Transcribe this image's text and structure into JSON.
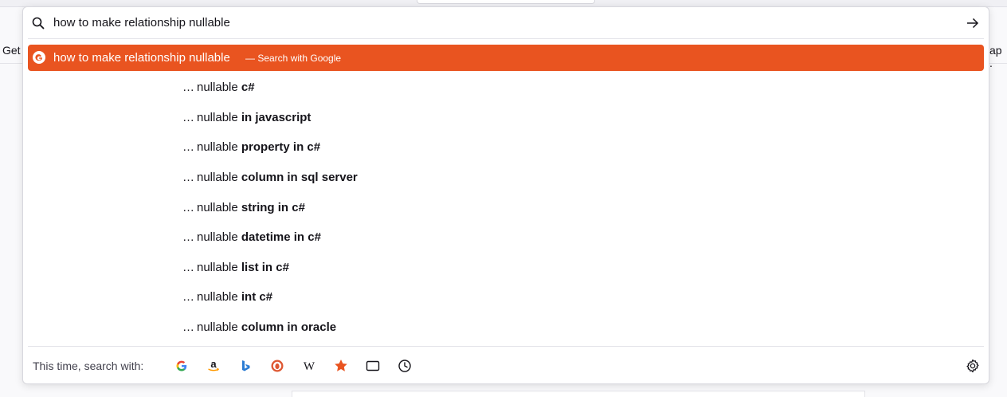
{
  "background": {
    "left_text": "Get",
    "right_text": "ap ."
  },
  "urlbar": {
    "input_value": "how to make relationship nullable"
  },
  "heuristic": {
    "query": "how to make relationship nullable",
    "action": "— Search with Google"
  },
  "suggestions": [
    {
      "ellipsis": "…",
      "base": "nullable ",
      "tail": "c#"
    },
    {
      "ellipsis": "…",
      "base": "nullable ",
      "tail": "in javascript"
    },
    {
      "ellipsis": "…",
      "base": "nullable ",
      "tail": "property in c#"
    },
    {
      "ellipsis": "…",
      "base": "nullable ",
      "tail": "column in sql server"
    },
    {
      "ellipsis": "…",
      "base": "nullable ",
      "tail": "string in c#"
    },
    {
      "ellipsis": "…",
      "base": "nullable ",
      "tail": "datetime in c#"
    },
    {
      "ellipsis": "…",
      "base": "nullable ",
      "tail": "list in c#"
    },
    {
      "ellipsis": "…",
      "base": "nullable ",
      "tail": "int c#"
    },
    {
      "ellipsis": "…",
      "base": "nullable ",
      "tail": "column in oracle"
    }
  ],
  "footer": {
    "label": "This time, search with:",
    "engines": [
      "google-icon",
      "amazon-icon",
      "bing-icon",
      "duckduckgo-icon",
      "wikipedia-icon",
      "bookmarks-star-icon",
      "tabs-icon",
      "history-clock-icon"
    ],
    "wikipedia_glyph": "W"
  },
  "colors": {
    "accent": "#e95420"
  }
}
